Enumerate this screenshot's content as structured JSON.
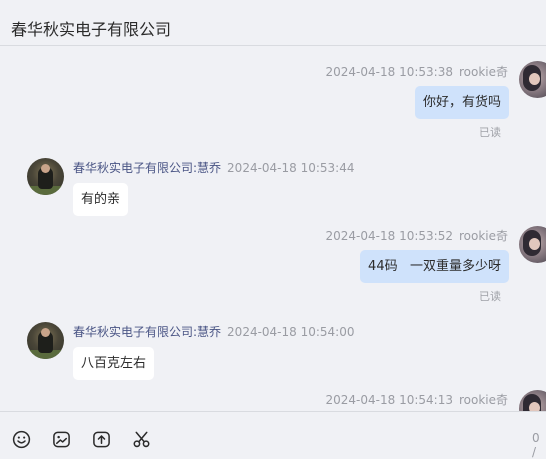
{
  "header": {
    "title": "春华秋实电子有限公司"
  },
  "messages": [
    {
      "direction": "out",
      "time": "2024-04-18 10:53:38",
      "name": "rookie奇",
      "text": "你好，有货吗",
      "status": "已读"
    },
    {
      "direction": "in",
      "sender": "春华秋实电子有限公司:慧乔",
      "time": "2024-04-18 10:53:44",
      "text": "有的亲"
    },
    {
      "direction": "out",
      "time": "2024-04-18 10:53:52",
      "name": "rookie奇",
      "text": "44码   一双重量多少呀",
      "status": "已读"
    },
    {
      "direction": "in",
      "sender": "春华秋实电子有限公司:慧乔",
      "time": "2024-04-18 10:54:00",
      "text": "八百克左右"
    },
    {
      "direction": "out",
      "time": "2024-04-18 10:54:13",
      "name": "rookie奇"
    }
  ],
  "toolbar": {
    "icons": [
      "emoji-icon",
      "image-icon",
      "upload-icon",
      "scissors-icon"
    ],
    "counter": "0 /"
  },
  "colors": {
    "background": "#f0f1f5",
    "outgoing_bubble": "#cfe2fb",
    "incoming_bubble": "#ffffff",
    "sender_name": "#4a5585"
  }
}
